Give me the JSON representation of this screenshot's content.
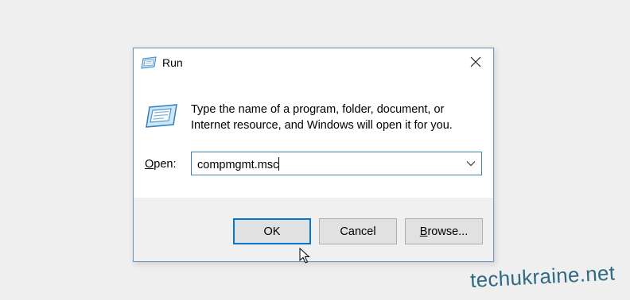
{
  "window": {
    "title": "Run",
    "icons": {
      "app": "run-icon",
      "close": "close-icon"
    }
  },
  "dialog": {
    "message_line1": "Type the name of a program, folder, document, or",
    "message_line2": "Internet resource, and Windows will open it for you.",
    "open_label_mnemonic": "O",
    "open_label_rest": "pen:",
    "open_value": "compmgmt.msc",
    "dropdown_icon": "chevron-down-icon"
  },
  "buttons": {
    "ok": "OK",
    "cancel": "Cancel",
    "browse_mnemonic": "B",
    "browse_rest": "rowse..."
  },
  "watermark": "techukraine.net",
  "colors": {
    "accent": "#0078d7",
    "window_border": "#6a98cc",
    "input_border": "#3c7fb1",
    "watermark": "#2f6a82"
  }
}
